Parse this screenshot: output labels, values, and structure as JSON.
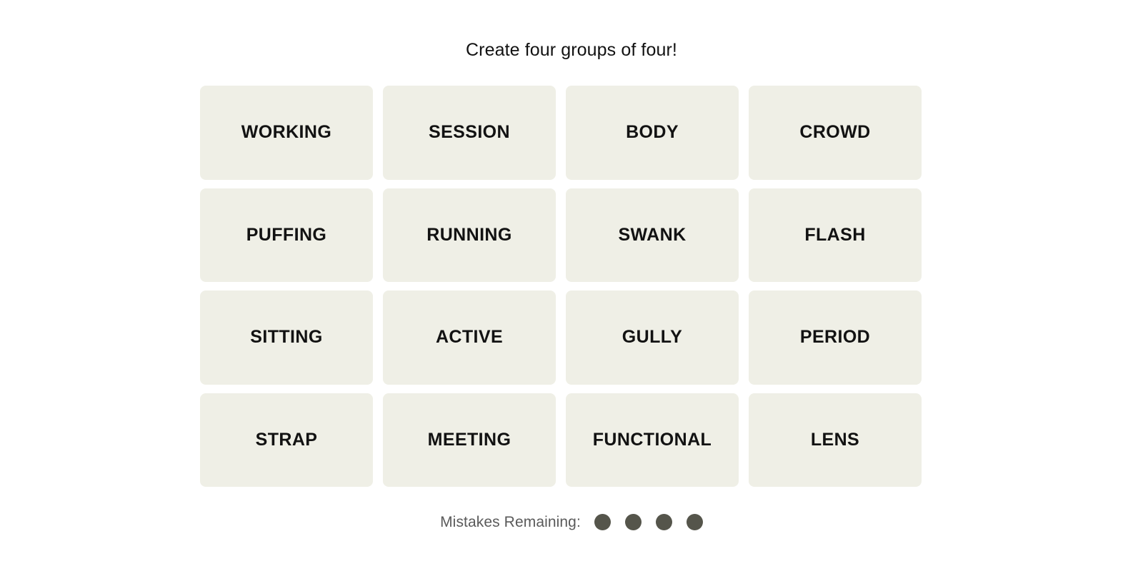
{
  "game": {
    "title": "Create four groups of four!",
    "tile_bg_color": "#EFEFE6",
    "tile_text_color": "#121212",
    "page_bg_color": "#FFFFFF"
  },
  "board": {
    "rows": 4,
    "columns": 4,
    "tiles": [
      {
        "label": "WORKING"
      },
      {
        "label": "SESSION"
      },
      {
        "label": "BODY"
      },
      {
        "label": "CROWD"
      },
      {
        "label": "PUFFING"
      },
      {
        "label": "RUNNING"
      },
      {
        "label": "SWANK"
      },
      {
        "label": "FLASH"
      },
      {
        "label": "SITTING"
      },
      {
        "label": "ACTIVE"
      },
      {
        "label": "GULLY"
      },
      {
        "label": "PERIOD"
      },
      {
        "label": "STRAP"
      },
      {
        "label": "MEETING"
      },
      {
        "label": "FUNCTIONAL"
      },
      {
        "label": "LENS"
      }
    ]
  },
  "mistakes": {
    "label": "Mistakes Remaining:",
    "remaining": 4,
    "dot_color": "#55554B",
    "label_color": "#5A5A5A",
    "dots": [
      {
        "name": "mistake-dot-1"
      },
      {
        "name": "mistake-dot-2"
      },
      {
        "name": "mistake-dot-3"
      },
      {
        "name": "mistake-dot-4"
      }
    ]
  }
}
